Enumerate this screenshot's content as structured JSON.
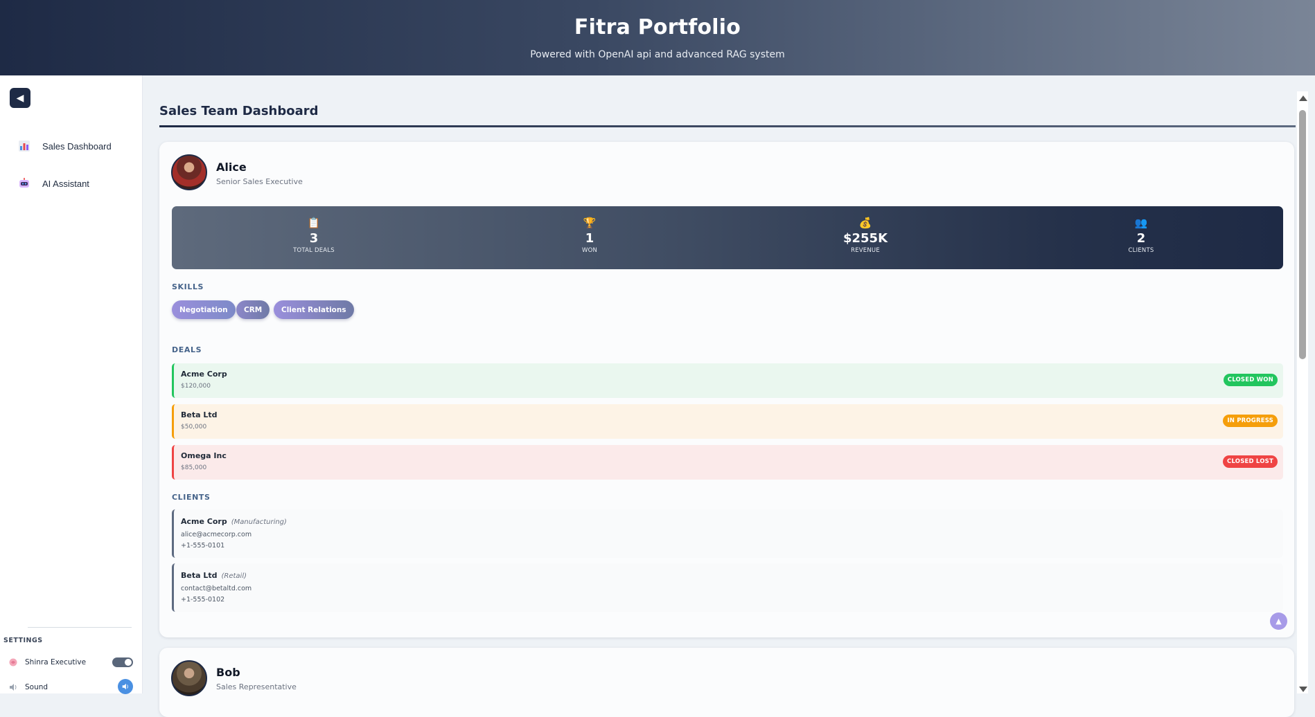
{
  "header": {
    "title": "Fitra Portfolio",
    "subtitle": "Powered with OpenAI api and advanced RAG system"
  },
  "sidebar": {
    "collapse_icon": "◀",
    "items": [
      {
        "label": "Sales Dashboard",
        "icon": "bar-chart-icon"
      },
      {
        "label": "AI Assistant",
        "icon": "robot-icon"
      }
    ],
    "settings": {
      "label": "SETTINGS",
      "rows": [
        {
          "label": "Shinra Executive",
          "control": "toggle",
          "state": "on"
        },
        {
          "label": "Sound",
          "control": "button",
          "icon": "speaker-icon"
        }
      ]
    }
  },
  "main": {
    "title": "Sales Team Dashboard",
    "members": [
      {
        "name": "Alice",
        "role": "Senior Sales Executive",
        "stats": [
          {
            "icon": "📋",
            "value": "3",
            "label": "TOTAL DEALS"
          },
          {
            "icon": "🏆",
            "value": "1",
            "label": "WON"
          },
          {
            "icon": "💰",
            "value": "$255K",
            "label": "REVENUE"
          },
          {
            "icon": "👥",
            "value": "2",
            "label": "CLIENTS"
          }
        ],
        "skills_label": "SKILLS",
        "skills": [
          "Negotiation",
          "CRM",
          "Client Relations"
        ],
        "deals_label": "DEALS",
        "deals": [
          {
            "name": "Acme Corp",
            "amount": "$120,000",
            "status": "CLOSED WON",
            "color": "#22c55e",
            "bg": "#eaf7ef"
          },
          {
            "name": "Beta Ltd",
            "amount": "$50,000",
            "status": "IN PROGRESS",
            "color": "#f59e0b",
            "bg": "#fdf3e6"
          },
          {
            "name": "Omega Inc",
            "amount": "$85,000",
            "status": "CLOSED LOST",
            "color": "#ef4444",
            "bg": "#fbeaea"
          }
        ],
        "clients_label": "CLIENTS",
        "clients": [
          {
            "name": "Acme Corp",
            "industry": "(Manufacturing)",
            "email": "alice@acmecorp.com",
            "phone": "+1-555-0101"
          },
          {
            "name": "Beta Ltd",
            "industry": "(Retail)",
            "email": "contact@betaltd.com",
            "phone": "+1-555-0102"
          }
        ]
      },
      {
        "name": "Bob",
        "role": "Sales Representative"
      }
    ],
    "scroll_top_icon": "▲"
  }
}
